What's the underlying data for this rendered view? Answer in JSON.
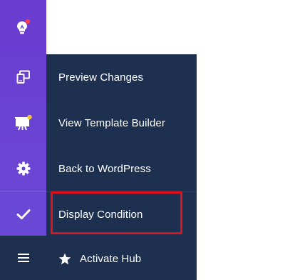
{
  "sidebar": {
    "items": [
      {
        "icon": "lightbulb-icon",
        "has_badge": true,
        "badge_color": "#ff3b4d"
      },
      {
        "icon": "responsive-devices-icon"
      },
      {
        "icon": "presentation-board-icon",
        "has_badge": true,
        "badge_color": "#f4c430"
      },
      {
        "icon": "gear-icon"
      },
      {
        "icon": "checkmark-icon"
      },
      {
        "icon": "hamburger-menu-icon"
      }
    ]
  },
  "menu": {
    "items": [
      {
        "label": "Preview Changes"
      },
      {
        "label": "View Template Builder"
      },
      {
        "label": "Back to WordPress"
      },
      {
        "label": "Display Condition",
        "highlighted": true
      },
      {
        "label": "Activate Hub",
        "icon": "star-icon"
      }
    ]
  },
  "colors": {
    "sidebar_purple": "#6b43d3",
    "menu_navy": "#1e3050",
    "highlight_red": "#e3121a",
    "badge_red": "#ff3b4d",
    "badge_yellow": "#f4c430"
  }
}
